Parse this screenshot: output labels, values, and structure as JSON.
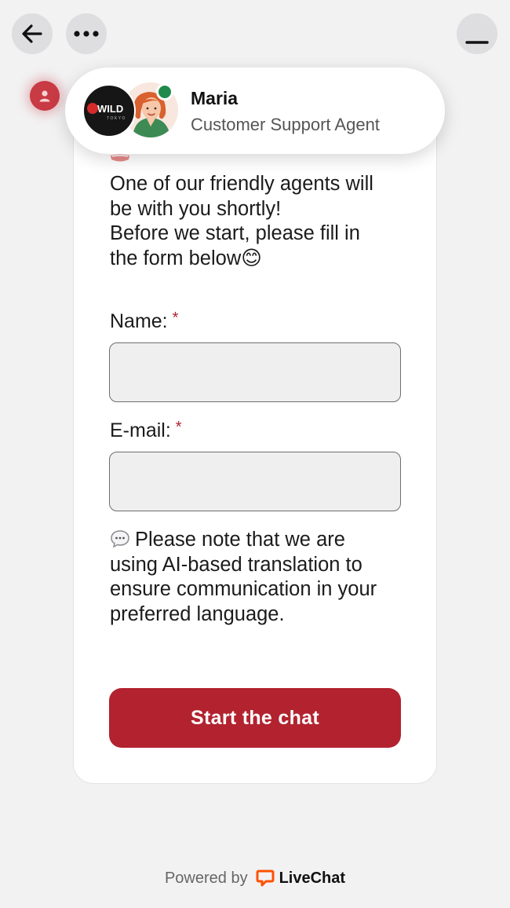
{
  "toolbar": {
    "back_icon": "arrow-left-icon",
    "more_icon": "ellipsis-icon",
    "minimize_icon": "minimize-icon"
  },
  "agent": {
    "name": "Maria",
    "role": "Customer Support Agent",
    "logo_text": "WILD",
    "logo_subtext": "TOKYO",
    "status": "online"
  },
  "intro": {
    "lines": [
      "One of our friendly agents will",
      "be with you shortly!",
      "Before we start, please fill in",
      "the form below😊"
    ]
  },
  "form": {
    "name_label": "Name:",
    "email_label": "E-mail:",
    "required_mark": "*",
    "name_value": "",
    "email_value": ""
  },
  "note": {
    "lines": [
      "Please note that we are",
      "using AI-based translation to",
      "ensure communication in your",
      "preferred language."
    ]
  },
  "start_button": {
    "label": "Start the chat"
  },
  "footer": {
    "powered_by": "Powered by",
    "brand": "LiveChat"
  },
  "colors": {
    "accent": "#b2232f",
    "background": "#f2f2f3",
    "online": "#1f8a4c",
    "livechat_orange": "#ff5100"
  }
}
